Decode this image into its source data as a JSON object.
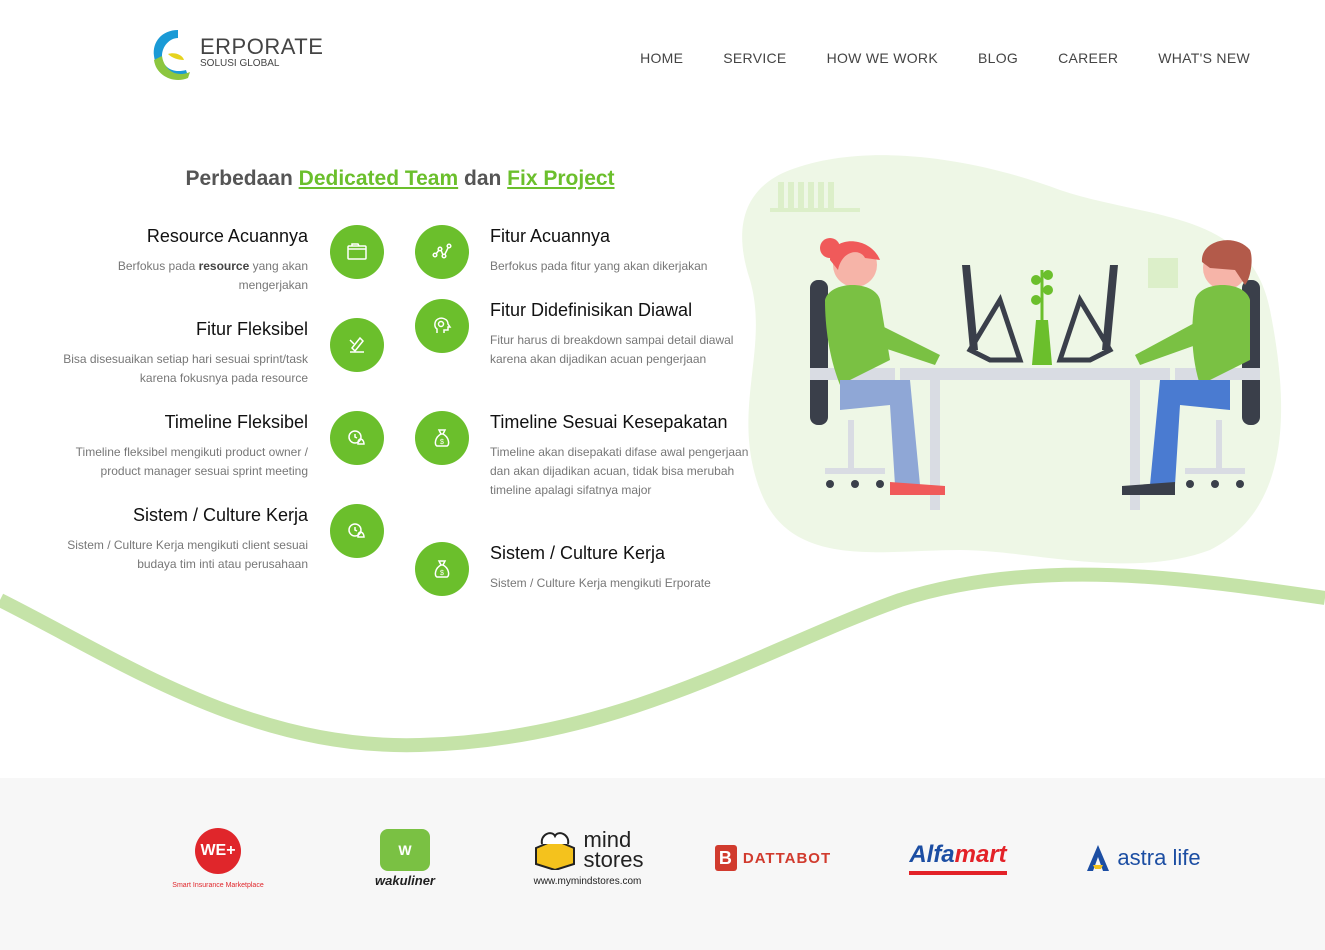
{
  "header": {
    "logo_text": "ERPORATE",
    "logo_sub": "SOLUSI GLOBAL",
    "nav": [
      "HOME",
      "SERVICE",
      "HOW WE WORK",
      "BLOG",
      "CAREER",
      "WHAT'S NEW"
    ]
  },
  "heading": {
    "prefix": "Perbedaan ",
    "dedicated": "Dedicated Team",
    "middle": " dan ",
    "fix": "Fix Project"
  },
  "left_features": [
    {
      "title": "Resource Acuannya",
      "desc_pre": "Berfokus pada ",
      "desc_bold": "resource",
      "desc_post": " yang akan mengerjakan",
      "icon": "folder-icon"
    },
    {
      "title": "Fitur Fleksibel",
      "desc": "Bisa disesuaikan setiap hari sesuai sprint/task karena fokusnya pada resource",
      "icon": "edit-icon"
    },
    {
      "title": "Timeline Fleksibel",
      "desc": "Timeline fleksibel mengikuti product owner / product manager sesuai sprint meeting",
      "icon": "alarm-bell-icon"
    },
    {
      "title": "Sistem / Culture Kerja",
      "desc": "Sistem / Culture Kerja mengikuti client sesuai budaya tim inti atau perusahaan",
      "icon": "alarm-bell-icon"
    }
  ],
  "right_features": [
    {
      "title": "Fitur Acuannya",
      "desc": "Berfokus pada fitur yang akan dikerjakan",
      "icon": "graph-nodes-icon"
    },
    {
      "title": "Fitur Didefinisikan Diawal",
      "desc": "Fitur harus di breakdown sampai detail diawal karena akan dijadikan acuan pengerjaan",
      "icon": "brain-head-icon"
    },
    {
      "title": "Timeline Sesuai Kesepakatan",
      "desc": "Timeline akan disepakati difase awal pengerjaan dan akan dijadikan acuan, tidak bisa merubah timeline apalagi sifatnya major",
      "icon": "money-bag-icon"
    },
    {
      "title": "Sistem / Culture Kerja",
      "desc": "Sistem / Culture Kerja mengikuti Erporate",
      "icon": "money-bag-icon"
    }
  ],
  "clients": {
    "we": {
      "mark": "WE+",
      "sub": "Smart Insurance Marketplace"
    },
    "wakuliner": {
      "mark": "W",
      "name": "wakuliner"
    },
    "mindstores": {
      "word1": "mind",
      "word2": "stores",
      "url": "www.mymindstores.com"
    },
    "dattabot": {
      "mark": "B",
      "name": "DATTABOT"
    },
    "alfamart": {
      "part1": "Alfa",
      "part2": "mart"
    },
    "astralife": {
      "name": "astra life"
    }
  },
  "colors": {
    "accent": "#6bbf2c",
    "wave": "#c5e3a8",
    "client_bg": "#f7f7f7"
  }
}
